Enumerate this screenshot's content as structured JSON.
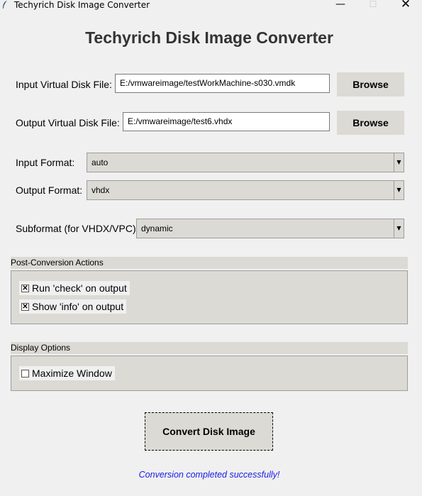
{
  "window": {
    "title": "Techyrich Disk Image Converter",
    "app_icon": "feather-icon",
    "minimize_glyph": "—",
    "maximize_glyph": "☐",
    "close_glyph": "✕"
  },
  "header": {
    "title": "Techyrich Disk Image Converter"
  },
  "input_file": {
    "label": "Input Virtual Disk File:",
    "value": "E:/vmwareimage/testWorkMachine-s030.vmdk",
    "browse_label": "Browse"
  },
  "output_file": {
    "label": "Output Virtual Disk File:",
    "value": "E:/vmwareimage/test6.vhdx",
    "browse_label": "Browse"
  },
  "input_format": {
    "label": "Input Format:",
    "value": "auto"
  },
  "output_format": {
    "label": "Output Format:",
    "value": "vhdx"
  },
  "subformat": {
    "label": "Subformat (for VHDX/VPC):",
    "value": "dynamic"
  },
  "post_actions": {
    "title": "Post-Conversion Actions",
    "items": [
      {
        "label": "Run 'check' on output",
        "checked": true,
        "mark": "✕"
      },
      {
        "label": "Show 'info' on output",
        "checked": true,
        "mark": "✕"
      }
    ]
  },
  "display_options": {
    "title": "Display Options",
    "items": [
      {
        "label": "Maximize Window",
        "checked": false,
        "mark": ""
      }
    ]
  },
  "convert_button": {
    "label": "Convert Disk Image"
  },
  "status": {
    "text": "Conversion completed successfully!",
    "color": "#1a1ae6"
  },
  "colors": {
    "window_bg": "#f0f0f0",
    "control_bg": "#dcdad5",
    "title_text": "#333333"
  }
}
